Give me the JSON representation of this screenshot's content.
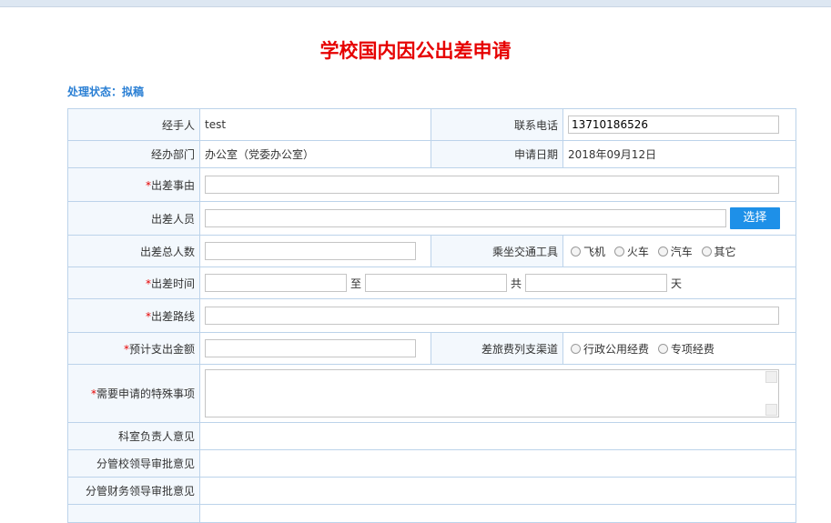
{
  "page": {
    "title": "学校国内因公出差申请"
  },
  "status": {
    "label": "处理状态：",
    "value": "拟稿"
  },
  "form": {
    "handler_label": "经手人",
    "handler_value": "test",
    "phone_label": "联系电话",
    "phone_value": "13710186526",
    "dept_label": "经办部门",
    "dept_value": "办公室（党委办公室）",
    "date_label": "申请日期",
    "date_value": "2018年09月12日",
    "reason_label": "出差事由",
    "staff_label": "出差人员",
    "select_button": "选择",
    "count_label": "出差总人数",
    "transport_label": "乘坐交通工具",
    "transport_options": [
      "飞机",
      "火车",
      "汽车",
      "其它"
    ],
    "time_label": "出差时间",
    "time_to": "至",
    "time_total": "共",
    "time_days": "天",
    "route_label": "出差路线",
    "amount_label": "预计支出金额",
    "channel_label": "差旅费列支渠道",
    "channel_options": [
      "行政公用经费",
      "专项经费"
    ],
    "special_label": "需要申请的特殊事项",
    "dept_head_label": "科室负责人意见",
    "school_leader_label": "分管校领导审批意见",
    "finance_leader_label": "分管财务领导审批意见",
    "required_mark": "*"
  }
}
